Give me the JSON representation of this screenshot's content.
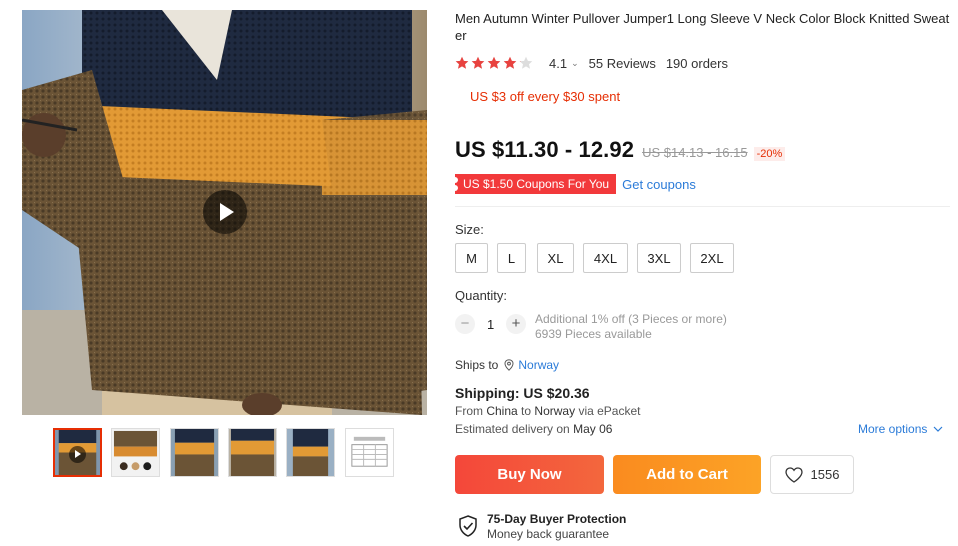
{
  "product": {
    "title": "Men Autumn Winter Pullover Jumper1 Long Sleeve V Neck Color Block Knitted Sweater",
    "rating": {
      "stars": 4.1,
      "value": "4.1",
      "caret_icon": "chevron-down-icon",
      "reviews": "55 Reviews",
      "orders": "190 orders"
    },
    "promo": "US $3 off every $30 spent",
    "price": {
      "current": "US $11.30 - 12.92",
      "original": "US $14.13 - 16.15",
      "discount": "-20%"
    },
    "coupon": {
      "tag": "US $1.50 Coupons For You",
      "link": "Get coupons"
    },
    "size": {
      "label": "Size:",
      "options": [
        "M",
        "L",
        "XL",
        "4XL",
        "3XL",
        "2XL"
      ]
    },
    "quantity": {
      "label": "Quantity:",
      "minus": "−",
      "value": "1",
      "plus": "+",
      "note": "Additional 1% off (3 Pieces or more)",
      "available": "6939 Pieces available"
    },
    "shipping": {
      "ships_to_label": "Ships to",
      "destination": "Norway",
      "price": "Shipping: US $20.36",
      "route_prefix": "From",
      "route_from": "China",
      "route_mid": "to",
      "route_to": "Norway",
      "route_suffix": "via ePacket",
      "delivery_prefix": "Estimated delivery on",
      "delivery_date": "May 06",
      "more_options": "More options"
    },
    "actions": {
      "buy_now": "Buy Now",
      "add_to_cart": "Add to Cart",
      "wishlist_count": "1556"
    },
    "protection": {
      "title": "75-Day Buyer Protection",
      "subtitle": "Money back guarantee"
    }
  },
  "colors": {
    "accent_red": "#e62e04",
    "link_blue": "#2b7bd8",
    "buy_now": "#f4473a",
    "add_to_cart": "#fa8b1f",
    "star": "#e8423f"
  },
  "gallery": {
    "thumbnail_count": 6,
    "active_thumbnail": 1
  }
}
